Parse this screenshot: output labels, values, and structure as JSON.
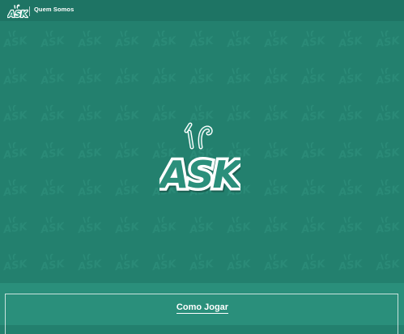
{
  "brand": {
    "name": "ASK",
    "icon": "ask-logo-icon"
  },
  "nav": {
    "about_label": "Quem Somos"
  },
  "hero": {
    "logo_text": "ASK",
    "pattern_text": "ASK",
    "icon": "ask-logo-icon"
  },
  "section": {
    "title": "Como Jogar"
  },
  "colors": {
    "background": "#23806e",
    "topbar": "#1e7464",
    "panel": "#2a8f7b",
    "logo_fill": "#2b8f7b",
    "logo_outline": "#ffffff"
  }
}
